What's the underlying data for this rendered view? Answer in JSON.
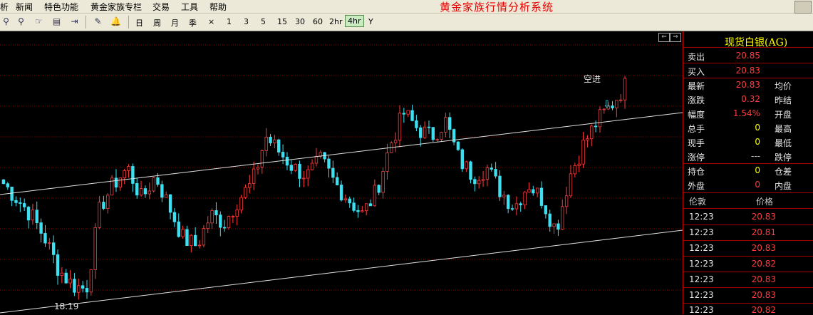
{
  "menu": {
    "items": [
      "析",
      "新闻",
      "特色功能",
      "黄金家族专栏",
      "交易",
      "工具",
      "帮助"
    ],
    "app_title": "黄金家族行情分析系统"
  },
  "toolbar": {
    "icons": [
      "zoom-in-icon",
      "zoom-out-icon",
      "hand-icon",
      "page-icon",
      "export-icon",
      "draw-tool-icon",
      "alarm-bell-icon"
    ],
    "periods": [
      "日",
      "周",
      "月",
      "季",
      "×",
      "1",
      "3",
      "5",
      "15",
      "30",
      "60",
      "2hr",
      "4hr",
      "Y"
    ],
    "active_period": "4hr"
  },
  "chart": {
    "annotation": "空进",
    "arrow": "⇩",
    "low_label": "18.19",
    "nav_left": "⇐",
    "nav_right": "⇒",
    "colors": {
      "up": "#ff3c3c",
      "down": "#3ce0f0",
      "trendline": "#e0e0e0",
      "grid": "#8a0000"
    }
  },
  "chart_data": {
    "type": "candlestick",
    "instrument": "现货白银(AG)",
    "period": "4hr",
    "low_marker": 18.19,
    "annotation": "空进",
    "series_close_trend": [
      19.6,
      19.4,
      19.2,
      18.9,
      18.5,
      18.3,
      18.25,
      19.3,
      19.6,
      19.8,
      19.4,
      19.7,
      19.3,
      18.9,
      18.8,
      19.2,
      19.1,
      19.4,
      19.6,
      20.2,
      20.0,
      19.8,
      19.7,
      19.9,
      19.6,
      19.4,
      19.2,
      19.5,
      20.1,
      20.5,
      20.3,
      20.2,
      20.4,
      19.9,
      19.7,
      19.8,
      19.5,
      19.3,
      19.6,
      19.4,
      19.0,
      19.7,
      20.1,
      20.4,
      20.6,
      20.85
    ]
  },
  "panel": {
    "title": "现货白银(AG)",
    "quote_rows": [
      {
        "label": "卖出",
        "value": "20.85",
        "label2": ""
      },
      {
        "label": "买入",
        "value": "20.83",
        "label2": ""
      },
      {
        "label": "最新",
        "value": "20.83",
        "label2": "均价"
      },
      {
        "label": "涨跌",
        "value": "0.32",
        "label2": "昨结"
      },
      {
        "label": "幅度",
        "value": "1.54%",
        "label2": "开盘"
      },
      {
        "label": "总手",
        "value": "0",
        "label2": "最高"
      },
      {
        "label": "现手",
        "value": "0",
        "label2": "最低"
      },
      {
        "label": "涨停",
        "value": "---",
        "label2": "跌停"
      },
      {
        "label": "持仓",
        "value": "0",
        "label2": "仓差"
      },
      {
        "label": "外盘",
        "value": "0",
        "label2": "内盘"
      }
    ],
    "tick_header": {
      "time": "伦敦",
      "price": "价格"
    },
    "ticks": [
      {
        "time": "12:23",
        "price": "20.83"
      },
      {
        "time": "12:23",
        "price": "20.81"
      },
      {
        "time": "12:23",
        "price": "20.83"
      },
      {
        "time": "12:23",
        "price": "20.82"
      },
      {
        "time": "12:23",
        "price": "20.83"
      },
      {
        "time": "12:23",
        "price": "20.83"
      },
      {
        "time": "12:23",
        "price": "20.82"
      }
    ]
  }
}
